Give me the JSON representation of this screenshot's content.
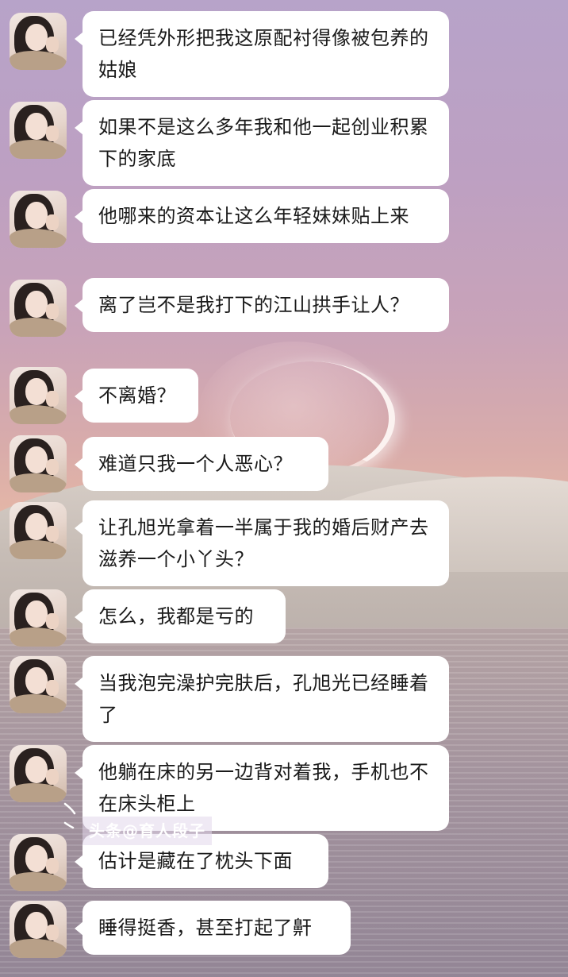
{
  "messages": [
    {
      "avatar": "contact-avatar",
      "text": "已经凭外形把我这原配衬得像被包养的姑娘"
    },
    {
      "avatar": "contact-avatar",
      "text": "如果不是这么多年我和他一起创业积累下的家底"
    },
    {
      "avatar": "contact-avatar",
      "text": "他哪来的资本让这么年轻妹妹贴上来"
    },
    {
      "avatar": "contact-avatar",
      "text": "离了岂不是我打下的江山拱手让人？"
    },
    {
      "avatar": "contact-avatar",
      "text": "不离婚？"
    },
    {
      "avatar": "contact-avatar",
      "text": "难道只我一个人恶心？"
    },
    {
      "avatar": "contact-avatar",
      "text": "让孔旭光拿着一半属于我的婚后财产去滋养一个小丫头？"
    },
    {
      "avatar": "contact-avatar",
      "text": "怎么，我都是亏的"
    },
    {
      "avatar": "contact-avatar",
      "text": "当我泡完澡护完肤后，孔旭光已经睡着了"
    },
    {
      "avatar": "contact-avatar",
      "text": "他躺在床的另一边背对着我，手机也不在床头柜上"
    },
    {
      "avatar": "contact-avatar",
      "text": "估计是藏在了枕头下面"
    },
    {
      "avatar": "contact-avatar",
      "text": "睡得挺香，甚至打起了鼾"
    }
  ],
  "watermark": "头条@育人段子",
  "colors": {
    "bubble": "#ffffff",
    "text": "#1a1a1a",
    "sky_top": "#b7a3c9",
    "horizon": "#e6b8a6"
  }
}
